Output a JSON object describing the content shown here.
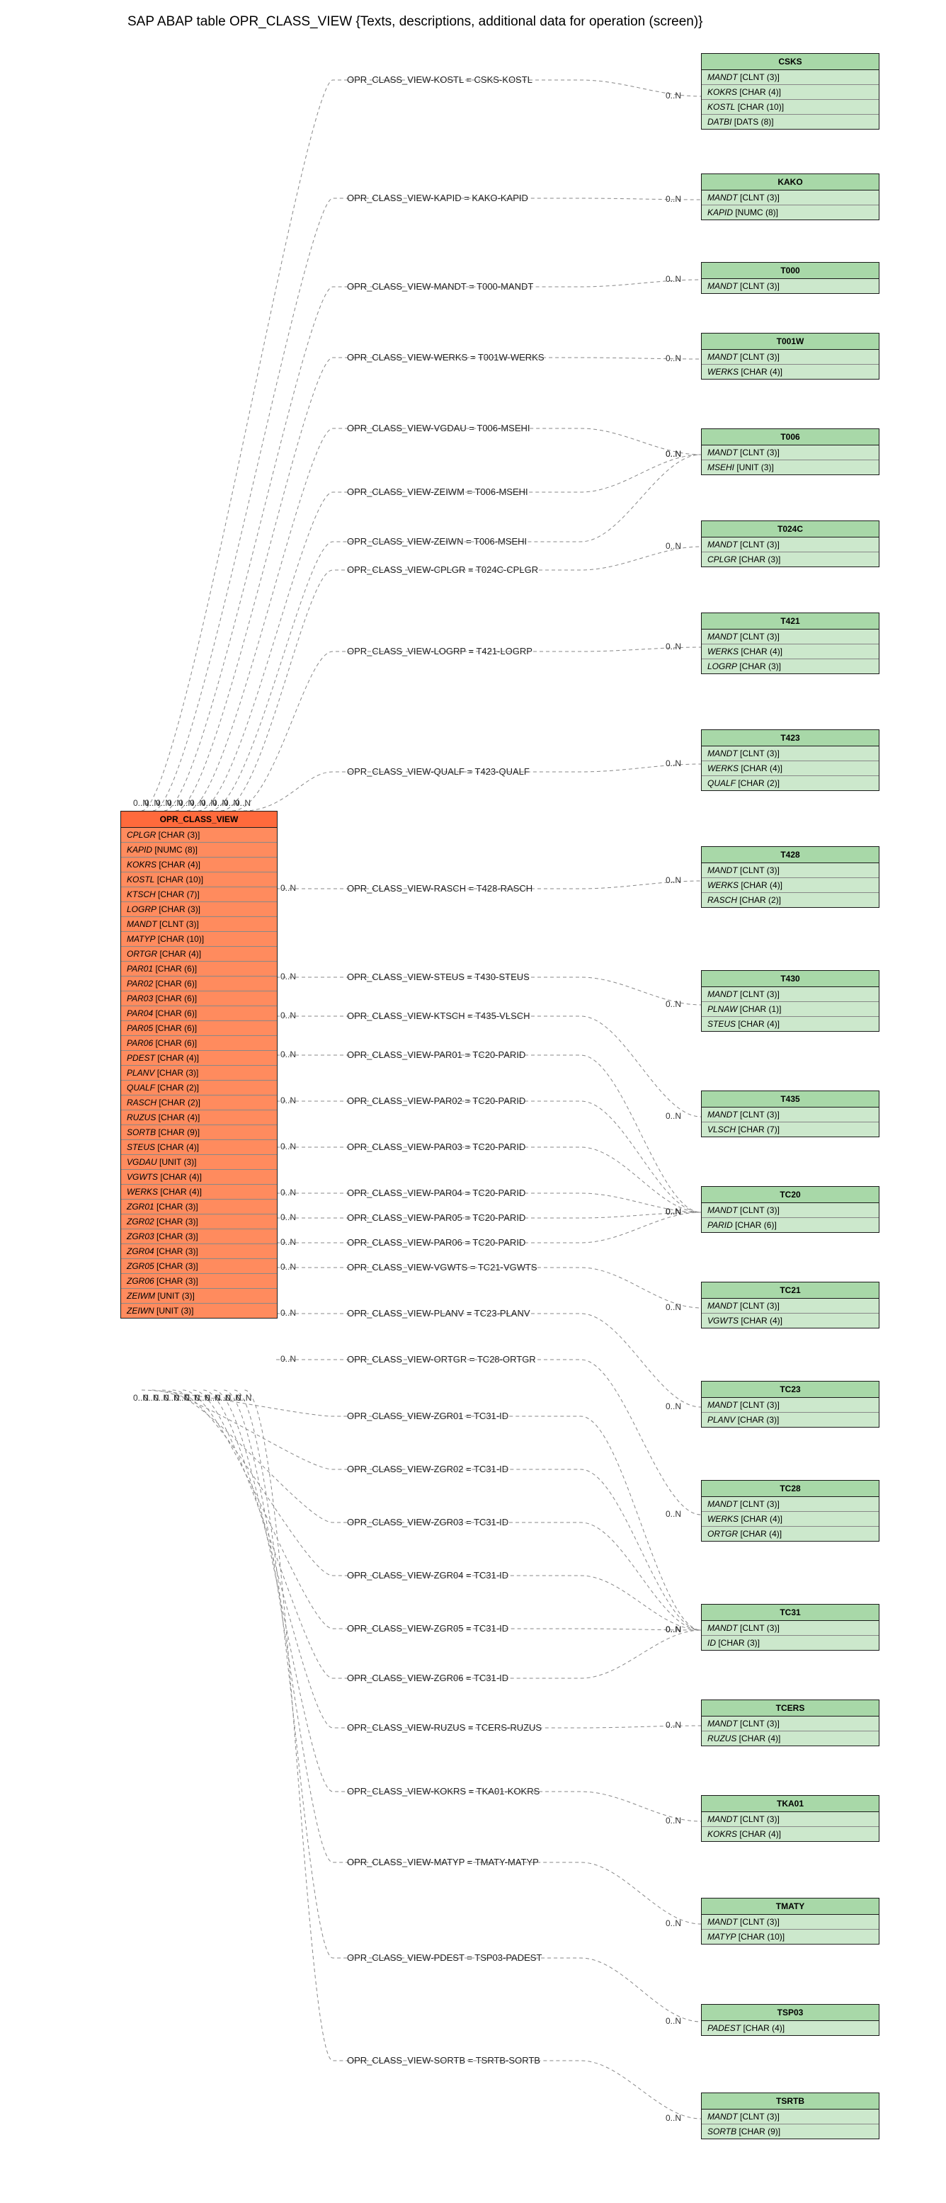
{
  "title": "SAP ABAP table OPR_CLASS_VIEW {Texts, descriptions, additional data for operation (screen)}",
  "source": {
    "name": "OPR_CLASS_VIEW",
    "fields": [
      "CPLGR [CHAR (3)]",
      "KAPID [NUMC (8)]",
      "KOKRS [CHAR (4)]",
      "KOSTL [CHAR (10)]",
      "KTSCH [CHAR (7)]",
      "LOGRP [CHAR (3)]",
      "MANDT [CLNT (3)]",
      "MATYP [CHAR (10)]",
      "ORTGR [CHAR (4)]",
      "PAR01 [CHAR (6)]",
      "PAR02 [CHAR (6)]",
      "PAR03 [CHAR (6)]",
      "PAR04 [CHAR (6)]",
      "PAR05 [CHAR (6)]",
      "PAR06 [CHAR (6)]",
      "PDEST [CHAR (4)]",
      "PLANV [CHAR (3)]",
      "QUALF [CHAR (2)]",
      "RASCH [CHAR (2)]",
      "RUZUS [CHAR (4)]",
      "SORTB [CHAR (9)]",
      "STEUS [CHAR (4)]",
      "VGDAU [UNIT (3)]",
      "VGWTS [CHAR (4)]",
      "WERKS [CHAR (4)]",
      "ZGR01 [CHAR (3)]",
      "ZGR02 [CHAR (3)]",
      "ZGR03 [CHAR (3)]",
      "ZGR04 [CHAR (3)]",
      "ZGR05 [CHAR (3)]",
      "ZGR06 [CHAR (3)]",
      "ZEIWM [UNIT (3)]",
      "ZEIWN [UNIT (3)]"
    ]
  },
  "targets": [
    {
      "name": "CSKS",
      "fields": [
        "MANDT [CLNT (3)]",
        "KOKRS [CHAR (4)]",
        "KOSTL [CHAR (10)]",
        "DATBI [DATS (8)]"
      ]
    },
    {
      "name": "KAKO",
      "fields": [
        "MANDT [CLNT (3)]",
        "KAPID [NUMC (8)]"
      ]
    },
    {
      "name": "T000",
      "fields": [
        "MANDT [CLNT (3)]"
      ]
    },
    {
      "name": "T001W",
      "fields": [
        "MANDT [CLNT (3)]",
        "WERKS [CHAR (4)]"
      ]
    },
    {
      "name": "T006",
      "fields": [
        "MANDT [CLNT (3)]",
        "MSEHI [UNIT (3)]"
      ]
    },
    {
      "name": "T024C",
      "fields": [
        "MANDT [CLNT (3)]",
        "CPLGR [CHAR (3)]"
      ]
    },
    {
      "name": "T421",
      "fields": [
        "MANDT [CLNT (3)]",
        "WERKS [CHAR (4)]",
        "LOGRP [CHAR (3)]"
      ]
    },
    {
      "name": "T423",
      "fields": [
        "MANDT [CLNT (3)]",
        "WERKS [CHAR (4)]",
        "QUALF [CHAR (2)]"
      ]
    },
    {
      "name": "T428",
      "fields": [
        "MANDT [CLNT (3)]",
        "WERKS [CHAR (4)]",
        "RASCH [CHAR (2)]"
      ]
    },
    {
      "name": "T430",
      "fields": [
        "MANDT [CLNT (3)]",
        "PLNAW [CHAR (1)]",
        "STEUS [CHAR (4)]"
      ]
    },
    {
      "name": "T435",
      "fields": [
        "MANDT [CLNT (3)]",
        "VLSCH [CHAR (7)]"
      ]
    },
    {
      "name": "TC20",
      "fields": [
        "MANDT [CLNT (3)]",
        "PARID [CHAR (6)]"
      ]
    },
    {
      "name": "TC21",
      "fields": [
        "MANDT [CLNT (3)]",
        "VGWTS [CHAR (4)]"
      ]
    },
    {
      "name": "TC23",
      "fields": [
        "MANDT [CLNT (3)]",
        "PLANV [CHAR (3)]"
      ]
    },
    {
      "name": "TC28",
      "fields": [
        "MANDT [CLNT (3)]",
        "WERKS [CHAR (4)]",
        "ORTGR [CHAR (4)]"
      ]
    },
    {
      "name": "TC31",
      "fields": [
        "MANDT [CLNT (3)]",
        "ID [CHAR (3)]"
      ]
    },
    {
      "name": "TCERS",
      "fields": [
        "MANDT [CLNT (3)]",
        "RUZUS [CHAR (4)]"
      ]
    },
    {
      "name": "TKA01",
      "fields": [
        "MANDT [CLNT (3)]",
        "KOKRS [CHAR (4)]"
      ]
    },
    {
      "name": "TMATY",
      "fields": [
        "MANDT [CLNT (3)]",
        "MATYP [CHAR (10)]"
      ]
    },
    {
      "name": "TSP03",
      "fields": [
        "PADEST [CHAR (4)]"
      ]
    },
    {
      "name": "TSRTB",
      "fields": [
        "MANDT [CLNT (3)]",
        "SORTB [CHAR (9)]"
      ]
    }
  ],
  "relations": [
    {
      "label": "OPR_CLASS_VIEW-KOSTL = CSKS-KOSTL",
      "target": "CSKS"
    },
    {
      "label": "OPR_CLASS_VIEW-KAPID = KAKO-KAPID",
      "target": "KAKO"
    },
    {
      "label": "OPR_CLASS_VIEW-MANDT = T000-MANDT",
      "target": "T000"
    },
    {
      "label": "OPR_CLASS_VIEW-WERKS = T001W-WERKS",
      "target": "T001W"
    },
    {
      "label": "OPR_CLASS_VIEW-VGDAU = T006-MSEHI",
      "target": "T006"
    },
    {
      "label": "OPR_CLASS_VIEW-ZEIWM = T006-MSEHI",
      "target": "T006"
    },
    {
      "label": "OPR_CLASS_VIEW-ZEIWN = T006-MSEHI",
      "target": "T006"
    },
    {
      "label": "OPR_CLASS_VIEW-CPLGR = T024C-CPLGR",
      "target": "T024C"
    },
    {
      "label": "OPR_CLASS_VIEW-LOGRP = T421-LOGRP",
      "target": "T421"
    },
    {
      "label": "OPR_CLASS_VIEW-QUALF = T423-QUALF",
      "target": "T423"
    },
    {
      "label": "OPR_CLASS_VIEW-RASCH = T428-RASCH",
      "target": "T428"
    },
    {
      "label": "OPR_CLASS_VIEW-STEUS = T430-STEUS",
      "target": "T430"
    },
    {
      "label": "OPR_CLASS_VIEW-KTSCH = T435-VLSCH",
      "target": "T435"
    },
    {
      "label": "OPR_CLASS_VIEW-PAR01 = TC20-PARID",
      "target": "TC20"
    },
    {
      "label": "OPR_CLASS_VIEW-PAR02 = TC20-PARID",
      "target": "TC20"
    },
    {
      "label": "OPR_CLASS_VIEW-PAR03 = TC20-PARID",
      "target": "TC20"
    },
    {
      "label": "OPR_CLASS_VIEW-PAR04 = TC20-PARID",
      "target": "TC20"
    },
    {
      "label": "OPR_CLASS_VIEW-PAR05 = TC20-PARID",
      "target": "TC20"
    },
    {
      "label": "OPR_CLASS_VIEW-PAR06 = TC20-PARID",
      "target": "TC20"
    },
    {
      "label": "OPR_CLASS_VIEW-VGWTS = TC21-VGWTS",
      "target": "TC21"
    },
    {
      "label": "OPR_CLASS_VIEW-PLANV = TC23-PLANV",
      "target": "TC23"
    },
    {
      "label": "OPR_CLASS_VIEW-ORTGR = TC28-ORTGR",
      "target": "TC28"
    },
    {
      "label": "OPR_CLASS_VIEW-ZGR01 = TC31-ID",
      "target": "TC31"
    },
    {
      "label": "OPR_CLASS_VIEW-ZGR02 = TC31-ID",
      "target": "TC31"
    },
    {
      "label": "OPR_CLASS_VIEW-ZGR03 = TC31-ID",
      "target": "TC31"
    },
    {
      "label": "OPR_CLASS_VIEW-ZGR04 = TC31-ID",
      "target": "TC31"
    },
    {
      "label": "OPR_CLASS_VIEW-ZGR05 = TC31-ID",
      "target": "TC31"
    },
    {
      "label": "OPR_CLASS_VIEW-ZGR06 = TC31-ID",
      "target": "TC31"
    },
    {
      "label": "OPR_CLASS_VIEW-RUZUS = TCERS-RUZUS",
      "target": "TCERS"
    },
    {
      "label": "OPR_CLASS_VIEW-KOKRS = TKA01-KOKRS",
      "target": "TKA01"
    },
    {
      "label": "OPR_CLASS_VIEW-MATYP = TMATY-MATYP",
      "target": "TMATY"
    },
    {
      "label": "OPR_CLASS_VIEW-PDEST = TSP03-PADEST",
      "target": "TSP03"
    },
    {
      "label": "OPR_CLASS_VIEW-SORTB = TSRTB-SORTB",
      "target": "TSRTB"
    }
  ],
  "cardinality": "0..N",
  "chart_data": {
    "type": "table",
    "description": "Entity-relationship diagram for SAP ABAP table OPR_CLASS_VIEW with related check tables",
    "main_entity": "OPR_CLASS_VIEW",
    "main_entity_fields": [
      "CPLGR",
      "KAPID",
      "KOKRS",
      "KOSTL",
      "KTSCH",
      "LOGRP",
      "MANDT",
      "MATYP",
      "ORTGR",
      "PAR01",
      "PAR02",
      "PAR03",
      "PAR04",
      "PAR05",
      "PAR06",
      "PDEST",
      "PLANV",
      "QUALF",
      "RASCH",
      "RUZUS",
      "SORTB",
      "STEUS",
      "VGDAU",
      "VGWTS",
      "WERKS",
      "ZGR01",
      "ZGR02",
      "ZGR03",
      "ZGR04",
      "ZGR05",
      "ZGR06",
      "ZEIWM",
      "ZEIWN"
    ],
    "foreign_keys": [
      {
        "from": "KOSTL",
        "to": "CSKS.KOSTL",
        "card": "0..N"
      },
      {
        "from": "KAPID",
        "to": "KAKO.KAPID",
        "card": "0..N"
      },
      {
        "from": "MANDT",
        "to": "T000.MANDT",
        "card": "0..N"
      },
      {
        "from": "WERKS",
        "to": "T001W.WERKS",
        "card": "0..N"
      },
      {
        "from": "VGDAU",
        "to": "T006.MSEHI",
        "card": "0..N"
      },
      {
        "from": "ZEIWM",
        "to": "T006.MSEHI",
        "card": "0..N"
      },
      {
        "from": "ZEIWN",
        "to": "T006.MSEHI",
        "card": "0..N"
      },
      {
        "from": "CPLGR",
        "to": "T024C.CPLGR",
        "card": "0..N"
      },
      {
        "from": "LOGRP",
        "to": "T421.LOGRP",
        "card": "0..N"
      },
      {
        "from": "QUALF",
        "to": "T423.QUALF",
        "card": "0..N"
      },
      {
        "from": "RASCH",
        "to": "T428.RASCH",
        "card": "0..N"
      },
      {
        "from": "STEUS",
        "to": "T430.STEUS",
        "card": "0..N"
      },
      {
        "from": "KTSCH",
        "to": "T435.VLSCH",
        "card": "0..N"
      },
      {
        "from": "PAR01",
        "to": "TC20.PARID",
        "card": "0..N"
      },
      {
        "from": "PAR02",
        "to": "TC20.PARID",
        "card": "0..N"
      },
      {
        "from": "PAR03",
        "to": "TC20.PARID",
        "card": "0..N"
      },
      {
        "from": "PAR04",
        "to": "TC20.PARID",
        "card": "0..N"
      },
      {
        "from": "PAR05",
        "to": "TC20.PARID",
        "card": "0..N"
      },
      {
        "from": "PAR06",
        "to": "TC20.PARID",
        "card": "0..N"
      },
      {
        "from": "VGWTS",
        "to": "TC21.VGWTS",
        "card": "0..N"
      },
      {
        "from": "PLANV",
        "to": "TC23.PLANV",
        "card": "0..N"
      },
      {
        "from": "ORTGR",
        "to": "TC28.ORTGR",
        "card": "0..N"
      },
      {
        "from": "ZGR01",
        "to": "TC31.ID",
        "card": "0..N"
      },
      {
        "from": "ZGR02",
        "to": "TC31.ID",
        "card": "0..N"
      },
      {
        "from": "ZGR03",
        "to": "TC31.ID",
        "card": "0..N"
      },
      {
        "from": "ZGR04",
        "to": "TC31.ID",
        "card": "0..N"
      },
      {
        "from": "ZGR05",
        "to": "TC31.ID",
        "card": "0..N"
      },
      {
        "from": "ZGR06",
        "to": "TC31.ID",
        "card": "0..N"
      },
      {
        "from": "RUZUS",
        "to": "TCERS.RUZUS",
        "card": "0..N"
      },
      {
        "from": "KOKRS",
        "to": "TKA01.KOKRS",
        "card": "0..N"
      },
      {
        "from": "MATYP",
        "to": "TMATY.MATYP",
        "card": "0..N"
      },
      {
        "from": "PDEST",
        "to": "TSP03.PADEST",
        "card": "0..N"
      },
      {
        "from": "SORTB",
        "to": "TSRTB.SORTB",
        "card": "0..N"
      }
    ]
  }
}
